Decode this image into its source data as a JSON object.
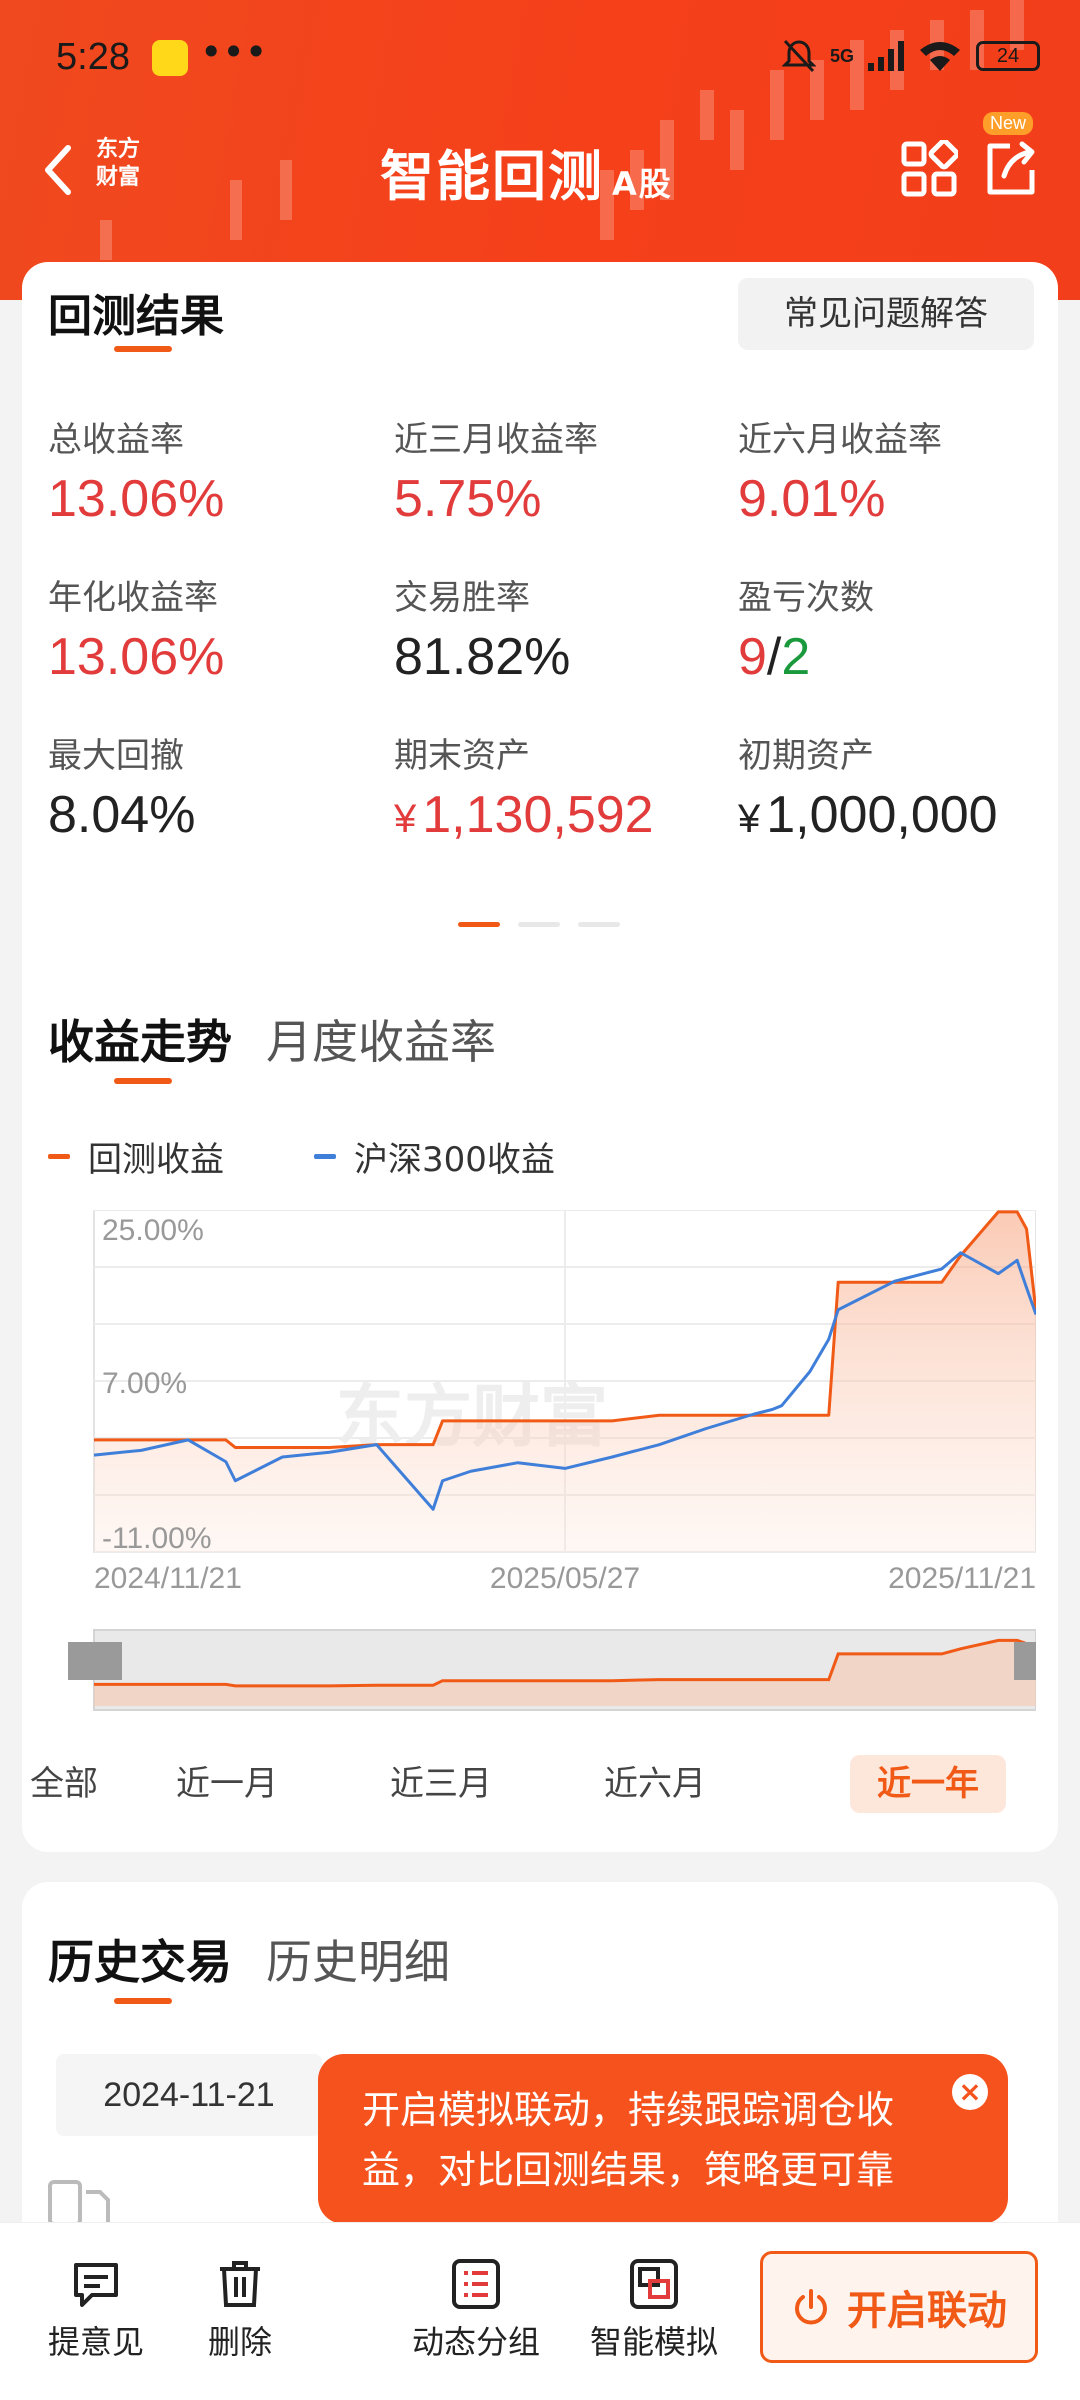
{
  "status_bar": {
    "time": "5:28",
    "more": "•••",
    "battery": "24",
    "signal": "5G"
  },
  "nav": {
    "logo_line1": "东方",
    "logo_line2": "财富",
    "title": "智能回测",
    "title_suffix": "A股",
    "new_tag": "New"
  },
  "results": {
    "title": "回测结果",
    "faq_button": "常见问题解答",
    "metrics": [
      {
        "label": "总收益率",
        "value": "13.06%",
        "color": "red"
      },
      {
        "label": "近三月收益率",
        "value": "5.75%",
        "color": "red"
      },
      {
        "label": "近六月收益率",
        "value": "9.01%",
        "color": "red"
      },
      {
        "label": "年化收益率",
        "value": "13.06%",
        "color": "red"
      },
      {
        "label": "交易胜率",
        "value": "81.82%",
        "color": "dark"
      },
      {
        "label": "盈亏次数",
        "win": "9",
        "sep": "/",
        "loss": "2"
      },
      {
        "label": "最大回撤",
        "value": "8.04%",
        "color": "dark"
      },
      {
        "label": "期末资产",
        "currency": "¥",
        "value": "1,130,592",
        "color": "red"
      },
      {
        "label": "初期资产",
        "currency": "¥",
        "value": "1,000,000",
        "color": "dark"
      }
    ]
  },
  "trend": {
    "tab_active": "收益走势",
    "tab_inactive": "月度收益率",
    "legend": [
      {
        "name": "回测收益",
        "color": "#f05a16"
      },
      {
        "name": "沪深300收益",
        "color": "#3f7fd9"
      }
    ],
    "range_tabs": [
      "全部",
      "近一月",
      "近三月",
      "近六月",
      "近一年"
    ],
    "range_active": "近一年",
    "watermark": "东方财富"
  },
  "chart_data": {
    "type": "line",
    "y_tick_labels": [
      "25.00%",
      "7.00%",
      "-11.00%"
    ],
    "ylim": [
      -11,
      25
    ],
    "x_tick_labels": [
      "2024/11/21",
      "2025/05/27",
      "2025/11/21"
    ],
    "x": [
      0,
      0.05,
      0.1,
      0.14,
      0.15,
      0.2,
      0.25,
      0.3,
      0.36,
      0.37,
      0.4,
      0.45,
      0.5,
      0.55,
      0.6,
      0.65,
      0.7,
      0.72,
      0.73,
      0.76,
      0.78,
      0.79,
      0.85,
      0.9,
      0.92,
      0.96,
      0.98,
      0.99,
      1.0
    ],
    "series": [
      {
        "name": "回测收益",
        "color": "#f05a16",
        "values": [
          0.8,
          0.8,
          0.8,
          0.8,
          0.0,
          0.0,
          0.0,
          0.3,
          0.3,
          2.8,
          2.8,
          2.8,
          2.8,
          2.8,
          3.4,
          3.4,
          3.4,
          3.4,
          3.4,
          3.4,
          3.4,
          17.4,
          17.4,
          17.4,
          20.2,
          24.8,
          24.8,
          23.0,
          14.3
        ]
      },
      {
        "name": "沪深300收益",
        "color": "#3f7fd9",
        "values": [
          -0.8,
          -0.3,
          0.8,
          -1.5,
          -3.5,
          -1.0,
          -0.5,
          0.3,
          -6.5,
          -3.5,
          -2.5,
          -1.6,
          -2.2,
          -1.0,
          0.3,
          2.0,
          3.5,
          4.0,
          4.4,
          8.0,
          11.4,
          14.5,
          17.5,
          18.8,
          20.5,
          18.3,
          19.7,
          16.8,
          14.0
        ]
      }
    ]
  },
  "history": {
    "tab_active": "历史交易",
    "tab_inactive": "历史明细",
    "date": "2024-11-21"
  },
  "tooltip": {
    "text": "开启模拟联动，持续跟踪调仓收益，对比回测结果，策略更可靠"
  },
  "bottom_bar": {
    "items": [
      {
        "label": "提意见",
        "icon": "feedback-icon"
      },
      {
        "label": "删除",
        "icon": "trash-icon"
      },
      {
        "label": "动态分组",
        "icon": "list-icon"
      },
      {
        "label": "智能模拟",
        "icon": "simulate-icon"
      }
    ],
    "start_button": "开启联动"
  }
}
